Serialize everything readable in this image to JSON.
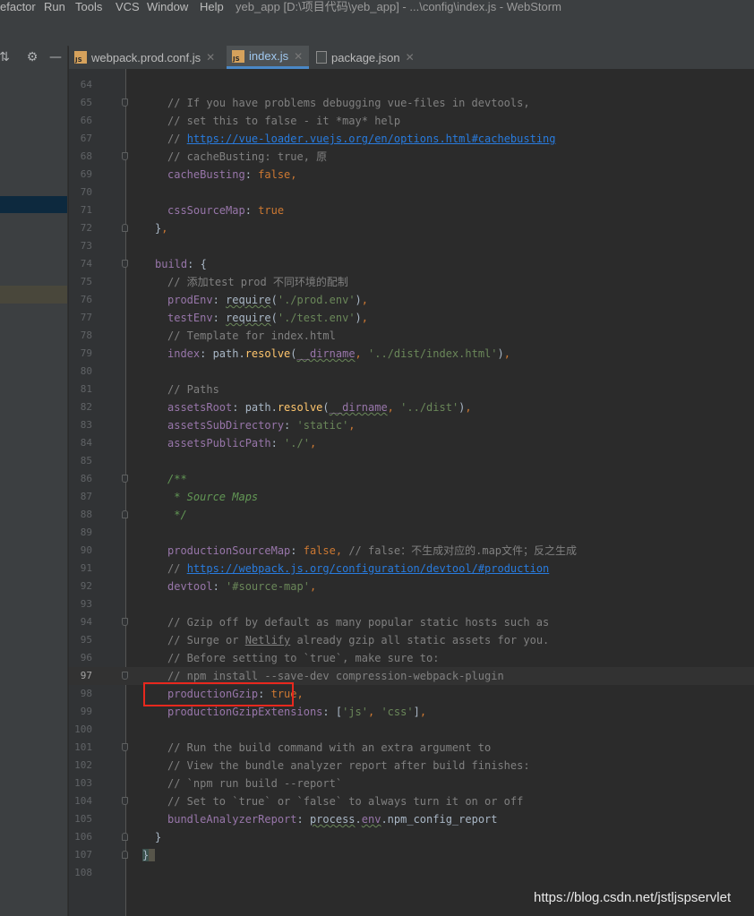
{
  "menubar": {
    "items": [
      {
        "label": "efactor"
      },
      {
        "label": "Run"
      },
      {
        "label": "Tools"
      },
      {
        "label": "VCS"
      },
      {
        "label": "Window"
      },
      {
        "label": "Help"
      }
    ],
    "title": "yeb_app [D:\\项目代码\\yeb_app] - ...\\config\\index.js - WebStorm"
  },
  "tabs": [
    {
      "label": "webpack.prod.conf.js",
      "icon": "js-file-icon",
      "active": false
    },
    {
      "label": "index.js",
      "icon": "js-file-icon",
      "active": true
    },
    {
      "label": "package.json",
      "icon": "json-file-icon",
      "active": false
    }
  ],
  "editor": {
    "current_line": 97,
    "lines": [
      {
        "n": "64",
        "code": ""
      },
      {
        "n": "65",
        "code": "// If you have problems debugging vue-files in devtools,"
      },
      {
        "n": "66",
        "code": "// set this to false - it *may* help"
      },
      {
        "n": "67",
        "code": "// https://vue-loader.vuejs.org/en/options.html#cachebusting"
      },
      {
        "n": "68",
        "code": "// cacheBusting: true, 原"
      },
      {
        "n": "69",
        "code": "cacheBusting: false,"
      },
      {
        "n": "70",
        "code": ""
      },
      {
        "n": "71",
        "code": "cssSourceMap: true"
      },
      {
        "n": "72",
        "code": "},"
      },
      {
        "n": "73",
        "code": ""
      },
      {
        "n": "74",
        "code": "build: {"
      },
      {
        "n": "75",
        "code": "// 添加test prod 不同环境的配制"
      },
      {
        "n": "76",
        "code": "prodEnv: require('./prod.env'),"
      },
      {
        "n": "77",
        "code": "testEnv: require('./test.env'),"
      },
      {
        "n": "78",
        "code": "// Template for index.html"
      },
      {
        "n": "79",
        "code": "index: path.resolve(__dirname, '../dist/index.html'),"
      },
      {
        "n": "80",
        "code": ""
      },
      {
        "n": "81",
        "code": "// Paths"
      },
      {
        "n": "82",
        "code": "assetsRoot: path.resolve(__dirname, '../dist'),"
      },
      {
        "n": "83",
        "code": "assetsSubDirectory: 'static',"
      },
      {
        "n": "84",
        "code": "assetsPublicPath: './',"
      },
      {
        "n": "85",
        "code": ""
      },
      {
        "n": "86",
        "code": "/**"
      },
      {
        "n": "87",
        "code": " * Source Maps"
      },
      {
        "n": "88",
        "code": " */"
      },
      {
        "n": "89",
        "code": ""
      },
      {
        "n": "90",
        "code": "productionSourceMap: false, // false：不生成对应的.map文件；反之生成"
      },
      {
        "n": "91",
        "code": "// https://webpack.js.org/configuration/devtool/#production"
      },
      {
        "n": "92",
        "code": "devtool: '#source-map',"
      },
      {
        "n": "93",
        "code": ""
      },
      {
        "n": "94",
        "code": "// Gzip off by default as many popular static hosts such as"
      },
      {
        "n": "95",
        "code": "// Surge or Netlify already gzip all static assets for you."
      },
      {
        "n": "96",
        "code": "// Before setting to `true`, make sure to:"
      },
      {
        "n": "97",
        "code": "// npm install --save-dev compression-webpack-plugin"
      },
      {
        "n": "98",
        "code": "productionGzip: true,"
      },
      {
        "n": "99",
        "code": "productionGzipExtensions: ['js', 'css'],"
      },
      {
        "n": "100",
        "code": ""
      },
      {
        "n": "101",
        "code": "// Run the build command with an extra argument to"
      },
      {
        "n": "102",
        "code": "// View the bundle analyzer report after build finishes:"
      },
      {
        "n": "103",
        "code": "// `npm run build --report`"
      },
      {
        "n": "104",
        "code": "// Set to `true` or `false` to always turn it on or off"
      },
      {
        "n": "105",
        "code": "bundleAnalyzerReport: process.env.npm_config_report"
      },
      {
        "n": "106",
        "code": "}"
      },
      {
        "n": "107",
        "code": "}"
      },
      {
        "n": "108",
        "code": ""
      }
    ]
  },
  "watermark": "https://blog.csdn.net/jstljspservlet",
  "colors": {
    "background": "#2b2b2b",
    "comment": "#808080",
    "property": "#9876aa",
    "keyword": "#cc7832",
    "string": "#6a8759",
    "highlight_box": "#e8281e"
  }
}
